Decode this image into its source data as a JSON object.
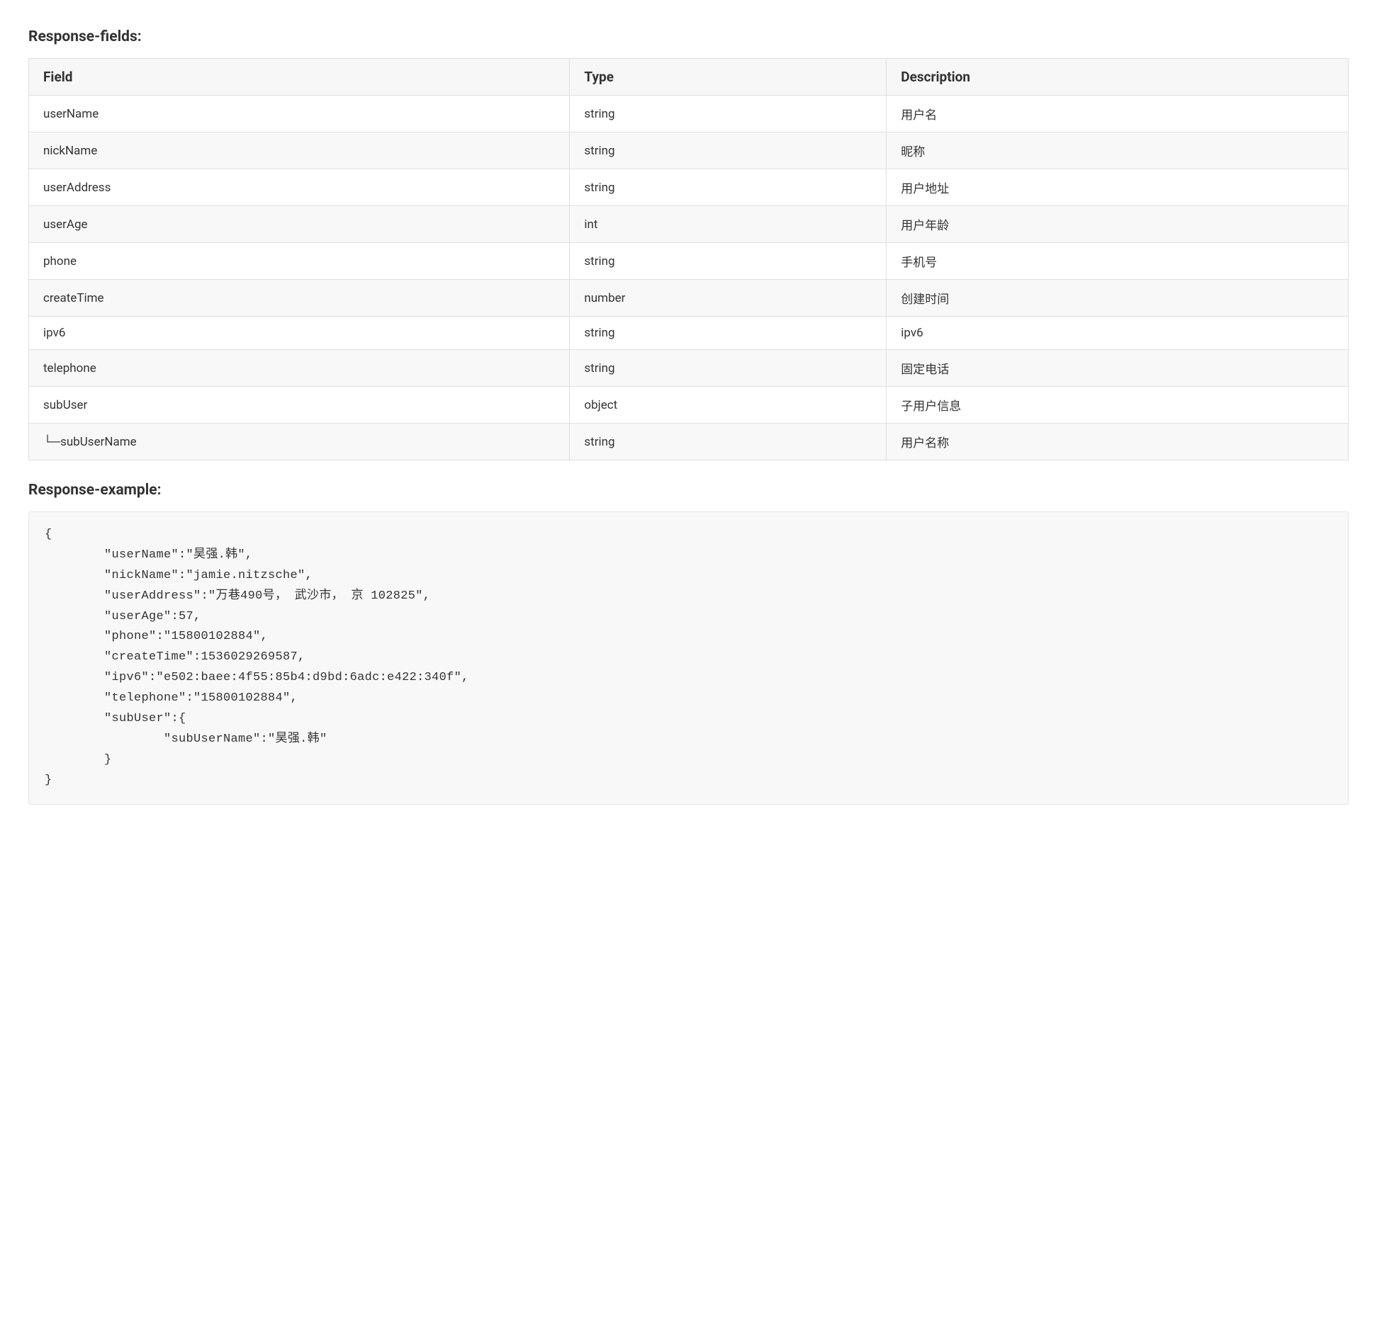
{
  "sections": {
    "responseFields": {
      "heading": "Response-fields:",
      "columns": [
        "Field",
        "Type",
        "Description"
      ],
      "rows": [
        {
          "field": "userName",
          "type": "string",
          "description": "用户名"
        },
        {
          "field": "nickName",
          "type": "string",
          "description": "昵称"
        },
        {
          "field": "userAddress",
          "type": "string",
          "description": "用户地址"
        },
        {
          "field": "userAge",
          "type": "int",
          "description": "用户年龄"
        },
        {
          "field": "phone",
          "type": "string",
          "description": "手机号"
        },
        {
          "field": "createTime",
          "type": "number",
          "description": "创建时间"
        },
        {
          "field": "ipv6",
          "type": "string",
          "description": "ipv6"
        },
        {
          "field": "telephone",
          "type": "string",
          "description": "固定电话"
        },
        {
          "field": "subUser",
          "type": "object",
          "description": "子用户信息"
        },
        {
          "field": "└─subUserName",
          "type": "string",
          "description": "用户名称"
        }
      ]
    },
    "responseExample": {
      "heading": "Response-example:",
      "code": "{\n        \"userName\":\"昊强.韩\",\n        \"nickName\":\"jamie.nitzsche\",\n        \"userAddress\":\"万巷490号， 武沙市， 京 102825\",\n        \"userAge\":57,\n        \"phone\":\"15800102884\",\n        \"createTime\":1536029269587,\n        \"ipv6\":\"e502:baee:4f55:85b4:d9bd:6adc:e422:340f\",\n        \"telephone\":\"15800102884\",\n        \"subUser\":{\n                \"subUserName\":\"昊强.韩\"\n        }\n}"
    }
  }
}
